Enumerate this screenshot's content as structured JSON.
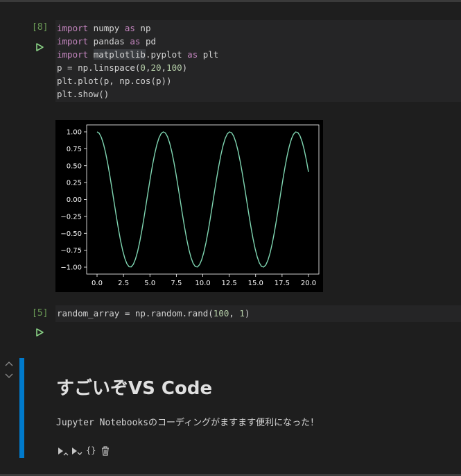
{
  "colors": {
    "background": "#1e1e1e",
    "cell_background": "#252526",
    "execution_count": "#6a9955",
    "keyword": "#c586c0",
    "number": "#b5cea8",
    "markdown_active_bar": "#007acc",
    "plot_line": "#7fd6b2"
  },
  "cells": [
    {
      "execution_count": "[8]",
      "code_lines": [
        [
          {
            "t": "import",
            "k": "kw"
          },
          {
            "t": " numpy ",
            "k": "plain"
          },
          {
            "t": "as",
            "k": "kw"
          },
          {
            "t": " np",
            "k": "plain"
          }
        ],
        [
          {
            "t": "import",
            "k": "kw"
          },
          {
            "t": " pandas ",
            "k": "plain"
          },
          {
            "t": "as",
            "k": "kw"
          },
          {
            "t": " pd",
            "k": "plain"
          }
        ],
        [
          {
            "t": "import",
            "k": "kw"
          },
          {
            "t": " ",
            "k": "plain"
          },
          {
            "t": "matplotlib",
            "k": "hl"
          },
          {
            "t": ".pyplot ",
            "k": "plain"
          },
          {
            "t": "as",
            "k": "kw"
          },
          {
            "t": " plt",
            "k": "plain"
          }
        ],
        [
          {
            "t": "p = np.linspace(",
            "k": "plain"
          },
          {
            "t": "0",
            "k": "num"
          },
          {
            "t": ",",
            "k": "plain"
          },
          {
            "t": "20",
            "k": "num"
          },
          {
            "t": ",",
            "k": "plain"
          },
          {
            "t": "100",
            "k": "num"
          },
          {
            "t": ")",
            "k": "plain"
          }
        ],
        [
          {
            "t": "plt.plot(p, np.cos(p))",
            "k": "plain"
          }
        ],
        [
          {
            "t": "plt.show()",
            "k": "plain"
          }
        ]
      ]
    },
    {
      "execution_count": "[5]",
      "code_lines": [
        [
          {
            "t": "random_array = np.random.rand(",
            "k": "plain"
          },
          {
            "t": "100",
            "k": "num"
          },
          {
            "t": ", ",
            "k": "plain"
          },
          {
            "t": "1",
            "k": "num"
          },
          {
            "t": ")",
            "k": "plain"
          }
        ]
      ]
    }
  ],
  "markdown_cell": {
    "heading": "すごいぞVS Code",
    "body": "Jupyter Notebooksのコーディングがますます便利になった！",
    "toolbar": [
      "run-above-icon",
      "run-below-icon",
      "curly-braces-icon",
      "trash-icon"
    ],
    "toolbar_text": {
      "braces": "{}"
    }
  },
  "chart_data": {
    "type": "line",
    "function": "cos",
    "series": [
      {
        "x_range": [
          0,
          20
        ],
        "n_points": 100
      }
    ],
    "xlim": [
      0,
      20
    ],
    "ylim": [
      -1,
      1
    ],
    "xticks": [
      0.0,
      2.5,
      5.0,
      7.5,
      10.0,
      12.5,
      15.0,
      17.5,
      20.0
    ],
    "xtick_labels": [
      "0.0",
      "2.5",
      "5.0",
      "7.5",
      "10.0",
      "12.5",
      "15.0",
      "17.5",
      "20.0"
    ],
    "yticks": [
      1.0,
      0.75,
      0.5,
      0.25,
      0.0,
      -0.25,
      -0.5,
      -0.75,
      -1.0
    ],
    "ytick_labels": [
      "1.00",
      "0.75",
      "0.50",
      "0.25",
      "0.00",
      "−0.25",
      "−0.50",
      "−0.75",
      "−1.00"
    ],
    "title": "",
    "xlabel": "",
    "ylabel": ""
  }
}
